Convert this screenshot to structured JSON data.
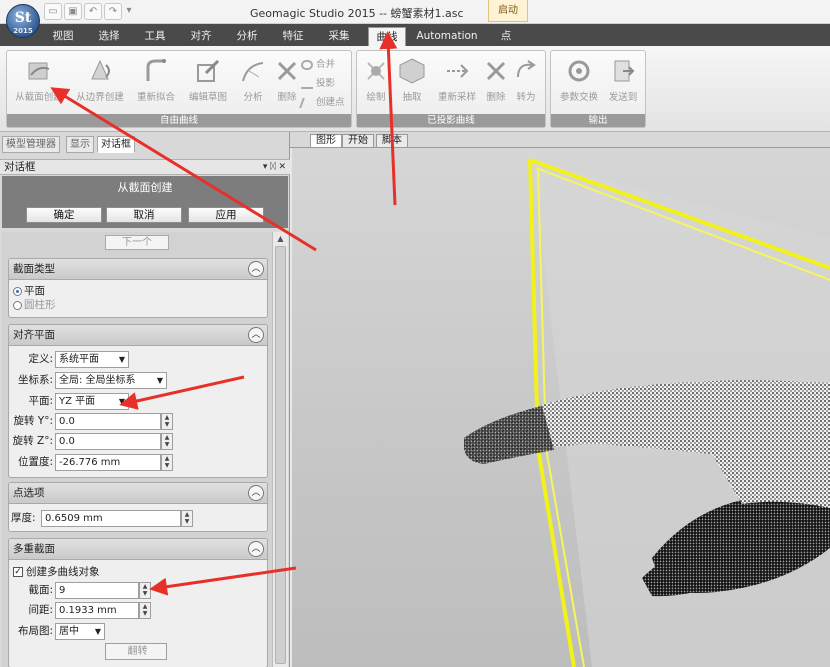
{
  "window": {
    "title": "Geomagic Studio 2015 -- 螃蟹素材1.asc",
    "context_tab": "启动",
    "logo_text": "St",
    "logo_sub": "2015"
  },
  "ribbon_tabs": [
    "视图",
    "选择",
    "工具",
    "对齐",
    "分析",
    "特征",
    "采集",
    "曲线",
    "Automation",
    "点"
  ],
  "active_tab": "曲线",
  "ribbon": {
    "free_curves": {
      "label": "自由曲线",
      "buttons": [
        "从截面创建",
        "从边界创建",
        "重新拟合",
        "编辑草图",
        "分析",
        "删除"
      ],
      "small": [
        "合并",
        "投影",
        "创建点"
      ]
    },
    "projected_curves": {
      "label": "已投影曲线",
      "buttons": [
        "绘制",
        "抽取",
        "重新采样",
        "删除",
        "转为"
      ]
    },
    "output": {
      "label": "输出",
      "buttons": [
        "参数交换",
        "发送到"
      ]
    }
  },
  "panel_tabs": [
    "模型管理器",
    "显示",
    "对话框"
  ],
  "active_panel_tab": "对话框",
  "dialog": {
    "header": "对话框",
    "header_ctrls": "▾ ᛞ ✕",
    "command_title": "从截面创建",
    "buttons": {
      "ok": "确定",
      "cancel": "取消",
      "apply": "应用"
    },
    "next": "下一个",
    "section_type": {
      "title": "截面类型",
      "options": [
        "平面",
        "圆柱形"
      ],
      "selected": "平面"
    },
    "align_plane": {
      "title": "对齐平面",
      "define_label": "定义:",
      "define_value": "系统平面",
      "coord_label": "坐标系:",
      "coord_value": "全局: 全局坐标系",
      "plane_label": "平面:",
      "plane_value": "YZ 平面",
      "rot_y_label": "旋转 Y°:",
      "rot_y_value": "0.0",
      "rot_z_label": "旋转 Z°:",
      "rot_z_value": "0.0",
      "pos_label": "位置度:",
      "pos_value": "-26.776 mm"
    },
    "point_options": {
      "title": "点选项",
      "thickness_label": "厚度:",
      "thickness_value": "0.6509 mm"
    },
    "multi_section": {
      "title": "多重截面",
      "create_label": "创建多曲线对象",
      "create_checked": true,
      "sections_label": "截面:",
      "sections_value": "9",
      "spacing_label": "间距:",
      "spacing_value": "0.1933 mm",
      "layout_label": "布局图:",
      "layout_value": "居中",
      "flip_label": "翻转"
    }
  },
  "view_tabs": [
    "图形",
    "开始",
    "脚本"
  ],
  "active_view_tab": "图形",
  "colors": {
    "plane_outline": "#f2f21a",
    "annotation_arrow": "#e8302a",
    "ribbon_dark": "#4a4a4a"
  }
}
